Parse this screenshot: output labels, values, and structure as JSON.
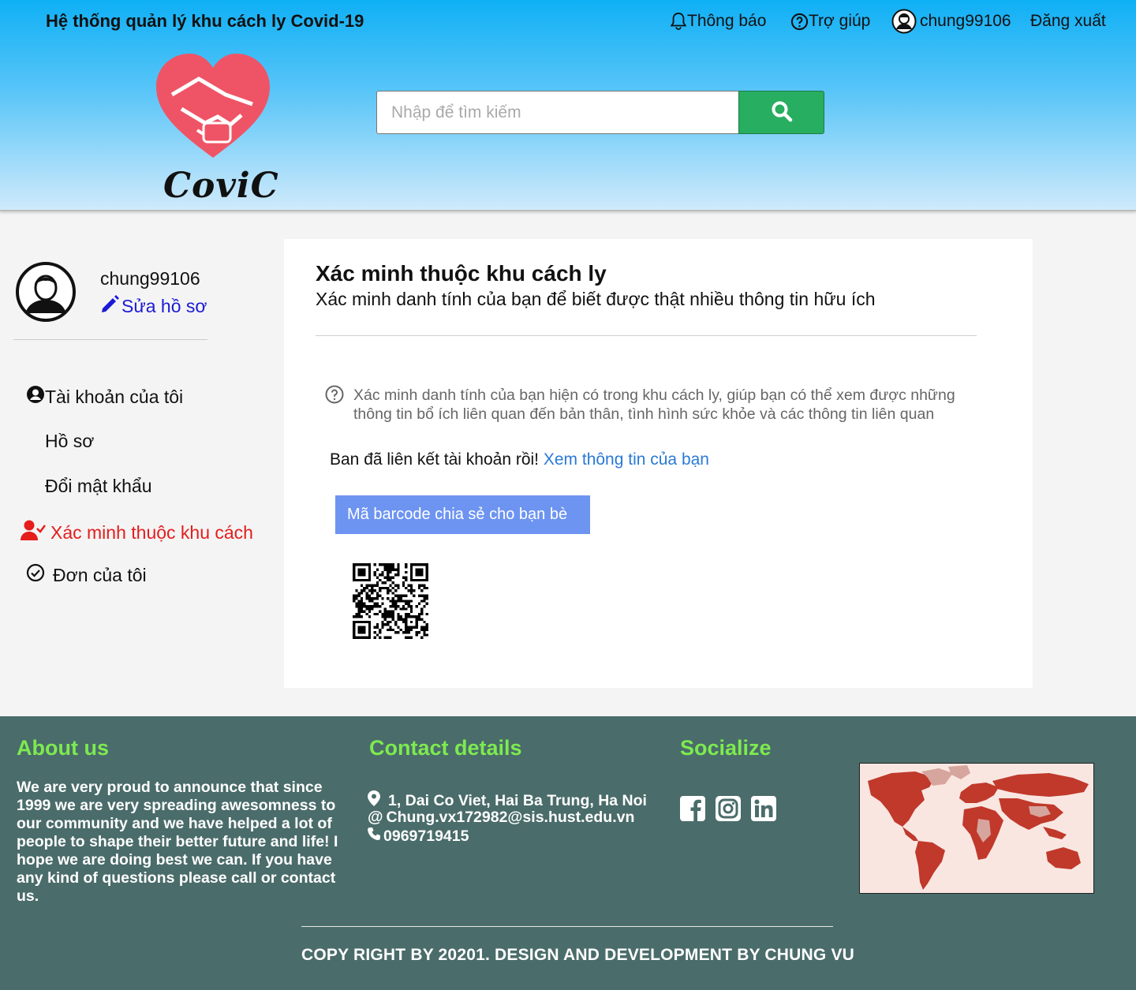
{
  "header": {
    "site_title": "Hệ thống quản lý khu cách  ly Covid-19",
    "nav": {
      "notify_label": "Thông báo",
      "help_label": "Trợ giúp",
      "username": "chung99106",
      "logout_label": "Đăng xuất"
    },
    "logo_text": "CoviC",
    "search": {
      "placeholder": "Nhập để tìm kiếm",
      "value": ""
    }
  },
  "sidebar": {
    "username": "chung99106",
    "edit_profile_label": "Sửa hồ sơ",
    "items": [
      {
        "label": "Tài khoản của tôi",
        "icon": "user-circle-icon"
      },
      {
        "label": "Hồ sơ"
      },
      {
        "label": "Đổi mật khẩu"
      },
      {
        "label": "Xác minh thuộc khu cách",
        "icon": "user-check-icon",
        "active": true
      },
      {
        "label": "Đơn của tôi",
        "icon": "check-circle-icon"
      }
    ]
  },
  "main": {
    "title": "Xác minh thuộc khu cách ly",
    "subtitle": "Xác minh danh tính của bạn để biết được thật nhiều thông tin hữu ích",
    "help_text": "Xác minh danh tính của bạn hiện có trong khu cách ly, giúp bạn có thể xem được những thông tin bổ ích liên quan đến bản thân, tình hình sức khỏe và các  thông tin liên quan",
    "linked_message": "Ban đã liên kết tài khoản rồi! ",
    "linked_link": "Xem thông tin của bạn",
    "barcode_button": "Mã barcode chia sẻ cho bạn bè"
  },
  "footer": {
    "about_heading": "About us",
    "about_text": "We are very proud to announce that since 1999 we are very spreading awesomness to our community and we have helped a lot of people to shape their better future and life! I hope we are doing best we can. If you have any kind of questions please call or contact us.",
    "contact_heading": "Contact details",
    "address": "1, Dai Co Viet, Hai Ba Trung, Ha Noi",
    "email": "Chung.vx172982@sis.hust.edu.vn",
    "phone": "0969719415",
    "social_heading": "Socialize",
    "social_icons": [
      "facebook-icon",
      "instagram-icon",
      "linkedin-icon"
    ],
    "copyright": "COPY RIGHT BY 20201. DESIGN AND DEVELOPMENT BY CHUNG VU"
  },
  "colors": {
    "header_top": "#0fb0f5",
    "search_button": "#27ae60",
    "active_item": "#e51d1d",
    "link": "#2a79d6",
    "edit_link": "#1a1ad6",
    "barcode_button": "#6d94f1",
    "footer_bg": "#4a6c6a",
    "footer_heading": "#7dea50",
    "logo_heart": "#ef5466"
  }
}
